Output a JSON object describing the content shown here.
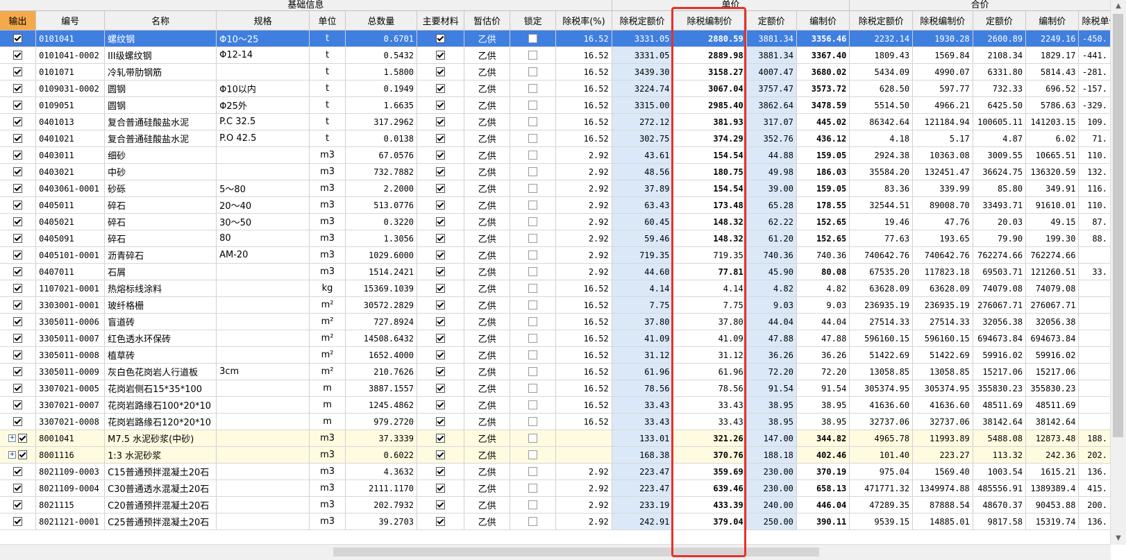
{
  "groups": {
    "base_info": "基础信息",
    "unit_price": "单价",
    "total_price": "合价"
  },
  "columns": [
    "输出",
    "编号",
    "名称",
    "规格",
    "单位",
    "总数量",
    "主要材料",
    "暂估价",
    "锁定",
    "除税率(%)",
    "除税定额价",
    "除税编制价",
    "定额价",
    "编制价",
    "除税定额价",
    "除税编制价",
    "定额价",
    "编制价",
    "除税单价"
  ],
  "rows": [
    {
      "out": true,
      "code": "0101041",
      "name": "螺纹钢",
      "spec": "Φ10～25",
      "unit": "t",
      "qty": "0.6701",
      "main": true,
      "est": "乙供",
      "lock": false,
      "rate": "16.52",
      "u_tax_quota": "3331.05",
      "u_tax_comp": "2880.59",
      "u_quota": "3881.34",
      "u_comp": "3356.46",
      "t_tax_quota": "2232.14",
      "t_tax_comp": "1930.28",
      "t_quota": "2600.89",
      "t_comp": "2249.16",
      "tax_unit": "-450.",
      "sel": true,
      "bold": true
    },
    {
      "out": true,
      "code": "0101041-0002",
      "name": "III级螺纹钢",
      "spec": "Φ12-14",
      "unit": "t",
      "qty": "0.5432",
      "main": true,
      "est": "乙供",
      "lock": false,
      "rate": "16.52",
      "u_tax_quota": "3331.05",
      "u_tax_comp": "2889.98",
      "u_quota": "3881.34",
      "u_comp": "3367.40",
      "t_tax_quota": "1809.43",
      "t_tax_comp": "1569.84",
      "t_quota": "2108.34",
      "t_comp": "1829.17",
      "tax_unit": "-441.",
      "bold": true
    },
    {
      "out": true,
      "code": "0101071",
      "name": "冷轧带肋钢筋",
      "spec": "",
      "unit": "t",
      "qty": "1.5800",
      "main": true,
      "est": "乙供",
      "lock": false,
      "rate": "16.52",
      "u_tax_quota": "3439.30",
      "u_tax_comp": "3158.27",
      "u_quota": "4007.47",
      "u_comp": "3680.02",
      "t_tax_quota": "5434.09",
      "t_tax_comp": "4990.07",
      "t_quota": "6331.80",
      "t_comp": "5814.43",
      "tax_unit": "-281.",
      "bold": true
    },
    {
      "out": true,
      "code": "0109031-0002",
      "name": "圆钢",
      "spec": "Φ10以内",
      "unit": "t",
      "qty": "0.1949",
      "main": true,
      "est": "乙供",
      "lock": false,
      "rate": "16.52",
      "u_tax_quota": "3224.74",
      "u_tax_comp": "3067.04",
      "u_quota": "3757.47",
      "u_comp": "3573.72",
      "t_tax_quota": "628.50",
      "t_tax_comp": "597.77",
      "t_quota": "732.33",
      "t_comp": "696.52",
      "tax_unit": "-157.",
      "bold": true
    },
    {
      "out": true,
      "code": "0109051",
      "name": "圆钢",
      "spec": "Φ25外",
      "unit": "t",
      "qty": "1.6635",
      "main": true,
      "est": "乙供",
      "lock": false,
      "rate": "16.52",
      "u_tax_quota": "3315.00",
      "u_tax_comp": "2985.40",
      "u_quota": "3862.64",
      "u_comp": "3478.59",
      "t_tax_quota": "5514.50",
      "t_tax_comp": "4966.21",
      "t_quota": "6425.50",
      "t_comp": "5786.63",
      "tax_unit": "-329.",
      "bold": true
    },
    {
      "out": true,
      "code": "0401013",
      "name": "复合普通硅酸盐水泥",
      "spec": "P.C  32.5",
      "unit": "t",
      "qty": "317.2962",
      "main": true,
      "est": "乙供",
      "lock": false,
      "rate": "16.52",
      "u_tax_quota": "272.12",
      "u_tax_comp": "381.93",
      "u_quota": "317.07",
      "u_comp": "445.02",
      "t_tax_quota": "86342.64",
      "t_tax_comp": "121184.94",
      "t_quota": "100605.11",
      "t_comp": "141203.15",
      "tax_unit": "109.",
      "bold": true
    },
    {
      "out": true,
      "code": "0401021",
      "name": "复合普通硅酸盐水泥",
      "spec": "P.O  42.5",
      "unit": "t",
      "qty": "0.0138",
      "main": true,
      "est": "乙供",
      "lock": false,
      "rate": "16.52",
      "u_tax_quota": "302.75",
      "u_tax_comp": "374.29",
      "u_quota": "352.76",
      "u_comp": "436.12",
      "t_tax_quota": "4.18",
      "t_tax_comp": "5.17",
      "t_quota": "4.87",
      "t_comp": "6.02",
      "tax_unit": "71.",
      "bold": true
    },
    {
      "out": true,
      "code": "0403011",
      "name": "细砂",
      "spec": "",
      "unit": "m3",
      "qty": "67.0576",
      "main": true,
      "est": "乙供",
      "lock": false,
      "rate": "2.92",
      "u_tax_quota": "43.61",
      "u_tax_comp": "154.54",
      "u_quota": "44.88",
      "u_comp": "159.05",
      "t_tax_quota": "2924.38",
      "t_tax_comp": "10363.08",
      "t_quota": "3009.55",
      "t_comp": "10665.51",
      "tax_unit": "110.",
      "bold": true
    },
    {
      "out": true,
      "code": "0403021",
      "name": "中砂",
      "spec": "",
      "unit": "m3",
      "qty": "732.7882",
      "main": true,
      "est": "乙供",
      "lock": false,
      "rate": "2.92",
      "u_tax_quota": "48.56",
      "u_tax_comp": "180.75",
      "u_quota": "49.98",
      "u_comp": "186.03",
      "t_tax_quota": "35584.20",
      "t_tax_comp": "132451.47",
      "t_quota": "36624.75",
      "t_comp": "136320.59",
      "tax_unit": "132.",
      "bold": true
    },
    {
      "out": true,
      "code": "0403061-0001",
      "name": "砂砾",
      "spec": "5～80",
      "unit": "m3",
      "qty": "2.2000",
      "main": true,
      "est": "乙供",
      "lock": false,
      "rate": "2.92",
      "u_tax_quota": "37.89",
      "u_tax_comp": "154.54",
      "u_quota": "39.00",
      "u_comp": "159.05",
      "t_tax_quota": "83.36",
      "t_tax_comp": "339.99",
      "t_quota": "85.80",
      "t_comp": "349.91",
      "tax_unit": "116.",
      "bold": true
    },
    {
      "out": true,
      "code": "0405011",
      "name": "碎石",
      "spec": "20～40",
      "unit": "m3",
      "qty": "513.0776",
      "main": true,
      "est": "乙供",
      "lock": false,
      "rate": "2.92",
      "u_tax_quota": "63.43",
      "u_tax_comp": "173.48",
      "u_quota": "65.28",
      "u_comp": "178.55",
      "t_tax_quota": "32544.51",
      "t_tax_comp": "89008.70",
      "t_quota": "33493.71",
      "t_comp": "91610.01",
      "tax_unit": "110.",
      "bold": true
    },
    {
      "out": true,
      "code": "0405021",
      "name": "碎石",
      "spec": "30～50",
      "unit": "m3",
      "qty": "0.3220",
      "main": true,
      "est": "乙供",
      "lock": false,
      "rate": "2.92",
      "u_tax_quota": "60.45",
      "u_tax_comp": "148.32",
      "u_quota": "62.22",
      "u_comp": "152.65",
      "t_tax_quota": "19.46",
      "t_tax_comp": "47.76",
      "t_quota": "20.03",
      "t_comp": "49.15",
      "tax_unit": "87.",
      "bold": true
    },
    {
      "out": true,
      "code": "0405091",
      "name": "碎石",
      "spec": "80",
      "unit": "m3",
      "qty": "1.3056",
      "main": true,
      "est": "乙供",
      "lock": false,
      "rate": "2.92",
      "u_tax_quota": "59.46",
      "u_tax_comp": "148.32",
      "u_quota": "61.20",
      "u_comp": "152.65",
      "t_tax_quota": "77.63",
      "t_tax_comp": "193.65",
      "t_quota": "79.90",
      "t_comp": "199.30",
      "tax_unit": "88.",
      "bold": true
    },
    {
      "out": true,
      "code": "0405101-0001",
      "name": "沥青碎石",
      "spec": "AM-20",
      "unit": "m3",
      "qty": "1029.6000",
      "main": true,
      "est": "乙供",
      "lock": false,
      "rate": "2.92",
      "u_tax_quota": "719.35",
      "u_tax_comp": "719.35",
      "u_quota": "740.36",
      "u_comp": "740.36",
      "t_tax_quota": "740642.76",
      "t_tax_comp": "740642.76",
      "t_quota": "762274.66",
      "t_comp": "762274.66",
      "tax_unit": "",
      "bold": false
    },
    {
      "out": true,
      "code": "0407011",
      "name": "石屑",
      "spec": "",
      "unit": "m3",
      "qty": "1514.2421",
      "main": true,
      "est": "乙供",
      "lock": false,
      "rate": "2.92",
      "u_tax_quota": "44.60",
      "u_tax_comp": "77.81",
      "u_quota": "45.90",
      "u_comp": "80.08",
      "t_tax_quota": "67535.20",
      "t_tax_comp": "117823.18",
      "t_quota": "69503.71",
      "t_comp": "121260.51",
      "tax_unit": "33.",
      "bold": true
    },
    {
      "out": true,
      "code": "1107021-0001",
      "name": "热熔标线涂料",
      "spec": "",
      "unit": "kg",
      "qty": "15369.1039",
      "main": true,
      "est": "乙供",
      "lock": false,
      "rate": "16.52",
      "u_tax_quota": "4.14",
      "u_tax_comp": "4.14",
      "u_quota": "4.82",
      "u_comp": "4.82",
      "t_tax_quota": "63628.09",
      "t_tax_comp": "63628.09",
      "t_quota": "74079.08",
      "t_comp": "74079.08",
      "tax_unit": "",
      "bold": false
    },
    {
      "out": true,
      "code": "3303001-0001",
      "name": "玻纤格栅",
      "spec": "",
      "unit": "m²",
      "qty": "30572.2829",
      "main": true,
      "est": "乙供",
      "lock": false,
      "rate": "16.52",
      "u_tax_quota": "7.75",
      "u_tax_comp": "7.75",
      "u_quota": "9.03",
      "u_comp": "9.03",
      "t_tax_quota": "236935.19",
      "t_tax_comp": "236935.19",
      "t_quota": "276067.71",
      "t_comp": "276067.71",
      "tax_unit": "",
      "bold": false
    },
    {
      "out": true,
      "code": "3305011-0006",
      "name": "盲道砖",
      "spec": "",
      "unit": "m²",
      "qty": "727.8924",
      "main": true,
      "est": "乙供",
      "lock": false,
      "rate": "16.52",
      "u_tax_quota": "37.80",
      "u_tax_comp": "37.80",
      "u_quota": "44.04",
      "u_comp": "44.04",
      "t_tax_quota": "27514.33",
      "t_tax_comp": "27514.33",
      "t_quota": "32056.38",
      "t_comp": "32056.38",
      "tax_unit": "",
      "bold": false
    },
    {
      "out": true,
      "code": "3305011-0007",
      "name": "红色透水环保砖",
      "spec": "",
      "unit": "m²",
      "qty": "14508.6432",
      "main": true,
      "est": "乙供",
      "lock": false,
      "rate": "16.52",
      "u_tax_quota": "41.09",
      "u_tax_comp": "41.09",
      "u_quota": "47.88",
      "u_comp": "47.88",
      "t_tax_quota": "596160.15",
      "t_tax_comp": "596160.15",
      "t_quota": "694673.84",
      "t_comp": "694673.84",
      "tax_unit": "",
      "bold": false
    },
    {
      "out": true,
      "code": "3305011-0008",
      "name": "植草砖",
      "spec": "",
      "unit": "m²",
      "qty": "1652.4000",
      "main": true,
      "est": "乙供",
      "lock": false,
      "rate": "16.52",
      "u_tax_quota": "31.12",
      "u_tax_comp": "31.12",
      "u_quota": "36.26",
      "u_comp": "36.26",
      "t_tax_quota": "51422.69",
      "t_tax_comp": "51422.69",
      "t_quota": "59916.02",
      "t_comp": "59916.02",
      "tax_unit": "",
      "bold": false
    },
    {
      "out": true,
      "code": "3305011-0009",
      "name": "灰白色花岗岩人行道板",
      "spec": "3cm",
      "unit": "m²",
      "qty": "210.7626",
      "main": true,
      "est": "乙供",
      "lock": false,
      "rate": "16.52",
      "u_tax_quota": "61.96",
      "u_tax_comp": "61.96",
      "u_quota": "72.20",
      "u_comp": "72.20",
      "t_tax_quota": "13058.85",
      "t_tax_comp": "13058.85",
      "t_quota": "15217.06",
      "t_comp": "15217.06",
      "tax_unit": "",
      "bold": false
    },
    {
      "out": true,
      "code": "3307021-0005",
      "name": "花岗岩侧石15*35*100",
      "spec": "",
      "unit": "m",
      "qty": "3887.1557",
      "main": true,
      "est": "乙供",
      "lock": false,
      "rate": "16.52",
      "u_tax_quota": "78.56",
      "u_tax_comp": "78.56",
      "u_quota": "91.54",
      "u_comp": "91.54",
      "t_tax_quota": "305374.95",
      "t_tax_comp": "305374.95",
      "t_quota": "355830.23",
      "t_comp": "355830.23",
      "tax_unit": "",
      "bold": false
    },
    {
      "out": true,
      "code": "3307021-0007",
      "name": "花岗岩路缘石100*20*10",
      "spec": "",
      "unit": "m",
      "qty": "1245.4862",
      "main": true,
      "est": "乙供",
      "lock": false,
      "rate": "16.52",
      "u_tax_quota": "33.43",
      "u_tax_comp": "33.43",
      "u_quota": "38.95",
      "u_comp": "38.95",
      "t_tax_quota": "41636.60",
      "t_tax_comp": "41636.60",
      "t_quota": "48511.69",
      "t_comp": "48511.69",
      "tax_unit": "",
      "bold": false
    },
    {
      "out": true,
      "code": "3307021-0008",
      "name": "花岗岩路缘石120*20*10",
      "spec": "",
      "unit": "m",
      "qty": "979.2720",
      "main": true,
      "est": "乙供",
      "lock": false,
      "rate": "16.52",
      "u_tax_quota": "33.43",
      "u_tax_comp": "33.43",
      "u_quota": "38.95",
      "u_comp": "38.95",
      "t_tax_quota": "32737.06",
      "t_tax_comp": "32737.06",
      "t_quota": "38142.64",
      "t_comp": "38142.64",
      "tax_unit": "",
      "bold": false
    },
    {
      "out": true,
      "code": "8001041",
      "name": "M7.5 水泥砂浆(中砂)",
      "spec": "",
      "unit": "m3",
      "qty": "37.3339",
      "main": true,
      "est": "乙供",
      "lock": false,
      "rate": "",
      "u_tax_quota": "133.01",
      "u_tax_comp": "321.26",
      "u_quota": "147.00",
      "u_comp": "344.82",
      "t_tax_quota": "4965.78",
      "t_tax_comp": "11993.89",
      "t_quota": "5488.08",
      "t_comp": "12873.48",
      "tax_unit": "188.",
      "bold": true,
      "expand": true,
      "yellow": true
    },
    {
      "out": true,
      "code": "8001116",
      "name": "1:3 水泥砂浆",
      "spec": "",
      "unit": "m3",
      "qty": "0.6022",
      "main": true,
      "est": "乙供",
      "lock": false,
      "rate": "",
      "u_tax_quota": "168.38",
      "u_tax_comp": "370.76",
      "u_quota": "188.18",
      "u_comp": "402.46",
      "t_tax_quota": "101.40",
      "t_tax_comp": "223.27",
      "t_quota": "113.32",
      "t_comp": "242.36",
      "tax_unit": "202.",
      "bold": true,
      "expand": true,
      "yellow": true
    },
    {
      "out": true,
      "code": "8021109-0003",
      "name": "C15普通预拌混凝土20石",
      "spec": "",
      "unit": "m3",
      "qty": "4.3632",
      "main": true,
      "est": "乙供",
      "lock": false,
      "rate": "2.92",
      "u_tax_quota": "223.47",
      "u_tax_comp": "359.69",
      "u_quota": "230.00",
      "u_comp": "370.19",
      "t_tax_quota": "975.04",
      "t_tax_comp": "1569.40",
      "t_quota": "1003.54",
      "t_comp": "1615.21",
      "tax_unit": "136.",
      "bold": true
    },
    {
      "out": true,
      "code": "8021109-0004",
      "name": "C30普通透水混凝土20石",
      "spec": "",
      "unit": "m3",
      "qty": "2111.1170",
      "main": true,
      "est": "乙供",
      "lock": false,
      "rate": "2.92",
      "u_tax_quota": "223.47",
      "u_tax_comp": "639.46",
      "u_quota": "230.00",
      "u_comp": "658.13",
      "t_tax_quota": "471771.32",
      "t_tax_comp": "1349974.88",
      "t_quota": "485556.91",
      "t_comp": "1389389.4",
      "tax_unit": "415.",
      "bold": true
    },
    {
      "out": true,
      "code": "8021115",
      "name": "C20普通预拌混凝土20石",
      "spec": "",
      "unit": "m3",
      "qty": "202.7932",
      "main": true,
      "est": "乙供",
      "lock": false,
      "rate": "2.92",
      "u_tax_quota": "233.19",
      "u_tax_comp": "433.39",
      "u_quota": "240.00",
      "u_comp": "446.04",
      "t_tax_quota": "47289.35",
      "t_tax_comp": "87888.54",
      "t_quota": "48670.37",
      "t_comp": "90453.88",
      "tax_unit": "200.",
      "bold": true
    },
    {
      "out": true,
      "code": "8021121-0001",
      "name": "C25普通预拌混凝土20石",
      "spec": "",
      "unit": "m3",
      "qty": "39.2703",
      "main": true,
      "est": "乙供",
      "lock": false,
      "rate": "2.92",
      "u_tax_quota": "242.91",
      "u_tax_comp": "379.04",
      "u_quota": "250.00",
      "u_comp": "390.11",
      "t_tax_quota": "9539.15",
      "t_tax_comp": "14885.01",
      "t_quota": "9817.58",
      "t_comp": "15319.74",
      "tax_unit": "136.",
      "bold": true
    }
  ],
  "colors": {
    "selected_row": "#3f7fe0",
    "output_header": "#f4a94a",
    "highlight_frame": "#e8302a",
    "quota_col": "#dbe8f7",
    "mortar_row": "#fffbe0"
  }
}
